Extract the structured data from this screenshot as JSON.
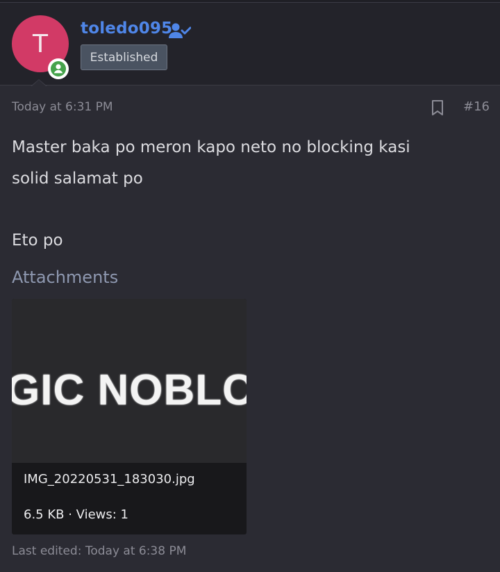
{
  "user": {
    "avatar_letter": "T",
    "username": "toledo095",
    "rank": "Established",
    "icons": [
      "online-status-icon",
      "verified-user-icon"
    ],
    "colors": {
      "avatar": "#d23a66",
      "username": "#4f86e8",
      "online": "#46a34c"
    }
  },
  "post": {
    "time": "Today at 6:31 PM",
    "number": "#16",
    "body_line1": "Master baka po meron kapo neto no blocking kasi",
    "body_line2": "solid salamat po",
    "body_line3": "Eto po",
    "last_edited": "Last edited: Today at 6:38 PM",
    "icons": [
      "bookmark-icon"
    ]
  },
  "attachments": {
    "title": "Attachments",
    "items": [
      {
        "thumb_text": "GIC NOBLC",
        "file_name": "IMG_20220531_183030.jpg",
        "meta": "6.5 KB · Views: 1"
      }
    ]
  }
}
